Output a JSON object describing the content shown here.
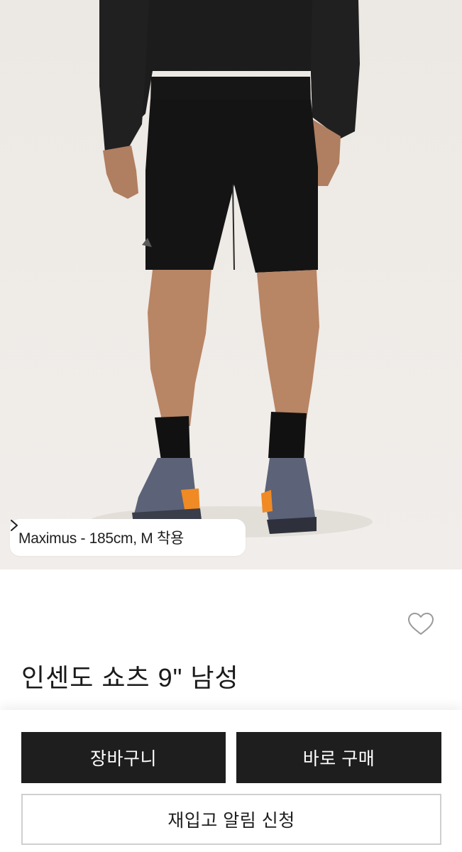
{
  "product": {
    "image_alt": "Black shorts worn by model with black socks and grey-orange trail shoes",
    "model_info": "Maximus - 185cm, M 착용",
    "title": "인센도 쇼츠 9\" 남성"
  },
  "icons": {
    "model_info_arrow": "chevron-right-icon",
    "wishlist": "heart-outline-icon"
  },
  "actions": {
    "cart_label": "장바구니",
    "buy_now_label": "바로 구매",
    "restock_alert_label": "재입고 알림 신청"
  },
  "colors": {
    "primary_button": "#1e1e1e",
    "page_background": "#ffffff",
    "photo_background": "#eeeae6",
    "shoe_accent": "#f08a24"
  }
}
